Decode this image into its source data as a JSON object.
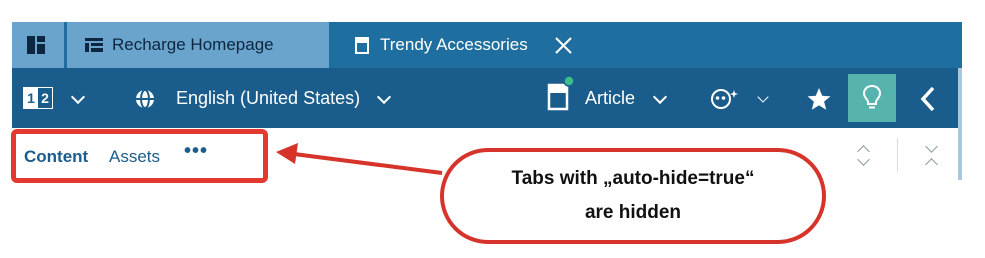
{
  "tabs": [
    {
      "label": "Recharge Homepage",
      "active": false
    },
    {
      "label": "Trendy Accessories",
      "active": true
    }
  ],
  "toolbar": {
    "compare_label": "1 2",
    "language": "English (United States)",
    "doc_type": "Article"
  },
  "content_tabs": {
    "content": "Content",
    "assets": "Assets",
    "more": "•••"
  },
  "annotation": {
    "line1": "Tabs with „auto-hide=true“",
    "line2": "are hidden"
  },
  "colors": {
    "tab_bar": "#1e6fa0",
    "inactive_tab": "#6aa3cc",
    "toolbar": "#1a5d8c",
    "idea_button": "#56b3ae",
    "annotation_red": "#e23a2e"
  },
  "icons": [
    "dashboard-icon",
    "page-icon",
    "document-icon",
    "close-icon",
    "globe-icon",
    "bot-icon",
    "star-icon",
    "lightbulb-icon",
    "chevron-left-icon"
  ]
}
